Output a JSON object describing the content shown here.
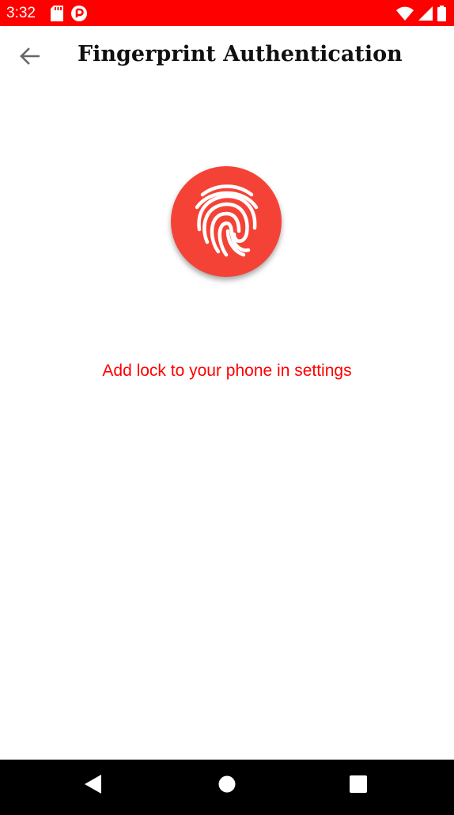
{
  "status_bar": {
    "time": "3:32",
    "left_icons": [
      "sd-card-icon",
      "notification-icon"
    ],
    "right_icons": [
      "wifi-icon",
      "cell-signal-icon",
      "battery-icon"
    ],
    "background": "#ff0000"
  },
  "app_bar": {
    "back_icon": "arrow-back-icon",
    "title": "Fingerprint Authentication"
  },
  "main": {
    "fingerprint_icon": "fingerprint-icon",
    "accent_color": "#f44336",
    "message": "Add lock to your phone in settings",
    "message_color": "#ff0000"
  },
  "nav_bar": {
    "buttons": [
      "back-triangle-icon",
      "home-circle-icon",
      "recents-square-icon"
    ]
  }
}
